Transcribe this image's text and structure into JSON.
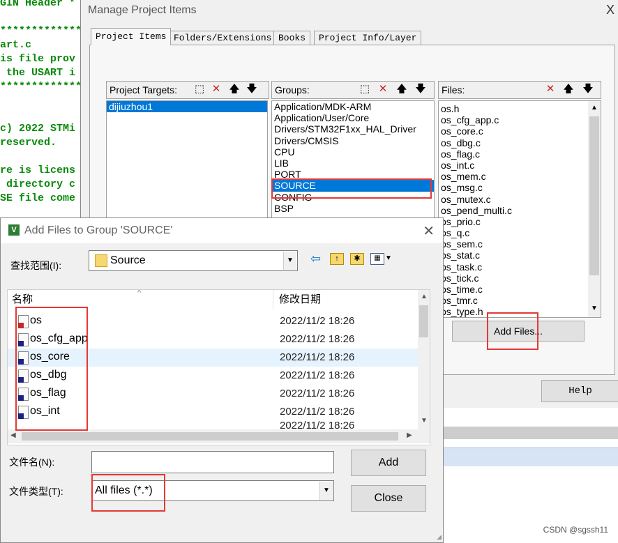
{
  "editor": {
    "lines": [
      "GIN Header *",
      "",
      "*************",
      "art.c",
      "is file prov",
      " the USART i",
      "*************",
      "",
      "",
      "c) 2022 STMi",
      "reserved.",
      "",
      "re is licens",
      " directory c",
      "SE file come"
    ]
  },
  "manage_dialog": {
    "title": "Manage Project Items",
    "close_glyph": "X",
    "tabs": [
      "Project Items",
      "Folders/Extensions",
      "Books",
      "Project Info/Layer"
    ],
    "targets_label": "Project Targets:",
    "targets": [
      "dijiuzhou1"
    ],
    "groups_label": "Groups:",
    "groups": [
      "Application/MDK-ARM",
      "Application/User/Core",
      "Drivers/STM32F1xx_HAL_Driver",
      "Drivers/CMSIS",
      "CPU",
      "LIB",
      "PORT",
      "SOURCE",
      "CONFIG",
      "BSP"
    ],
    "groups_selected": "SOURCE",
    "files_label": "Files:",
    "files": [
      "os.h",
      "os_cfg_app.c",
      "os_core.c",
      "os_dbg.c",
      "os_flag.c",
      "os_int.c",
      "os_mem.c",
      "os_msg.c",
      "os_mutex.c",
      "os_pend_multi.c",
      "os_prio.c",
      "os_q.c",
      "os_sem.c",
      "os_stat.c",
      "os_task.c",
      "os_tick.c",
      "os_time.c",
      "os_tmr.c",
      "os_type.h"
    ],
    "add_files_label": "Add Files...",
    "help_label": "Help"
  },
  "add_dialog": {
    "title": "Add Files to Group 'SOURCE'",
    "close_glyph": "✕",
    "app_icon_letter": "V",
    "lookin_label": "查找范围(I):",
    "lookin_value": "Source",
    "col_name": "名称",
    "col_date": "修改日期",
    "files": [
      {
        "name": "os",
        "date": "2022/11/2 18:26",
        "type": "h"
      },
      {
        "name": "os_cfg_app",
        "date": "2022/11/2 18:26",
        "type": "c"
      },
      {
        "name": "os_core",
        "date": "2022/11/2 18:26",
        "type": "c"
      },
      {
        "name": "os_dbg",
        "date": "2022/11/2 18:26",
        "type": "c"
      },
      {
        "name": "os_flag",
        "date": "2022/11/2 18:26",
        "type": "c"
      },
      {
        "name": "os_int",
        "date": "2022/11/2 18:26",
        "type": "c"
      }
    ],
    "partial_date": "2022/11/2 18:26",
    "filename_label": "文件名(N):",
    "filename_value": "",
    "filetype_label": "文件类型(T):",
    "filetype_value": "All files (*.*)",
    "add_label": "Add",
    "close_label": "Close"
  },
  "watermark": "CSDN @sgssh11",
  "colors": {
    "selection": "#0078d7",
    "highlight_box": "#e53935",
    "code_green": "#0a8a0a"
  }
}
